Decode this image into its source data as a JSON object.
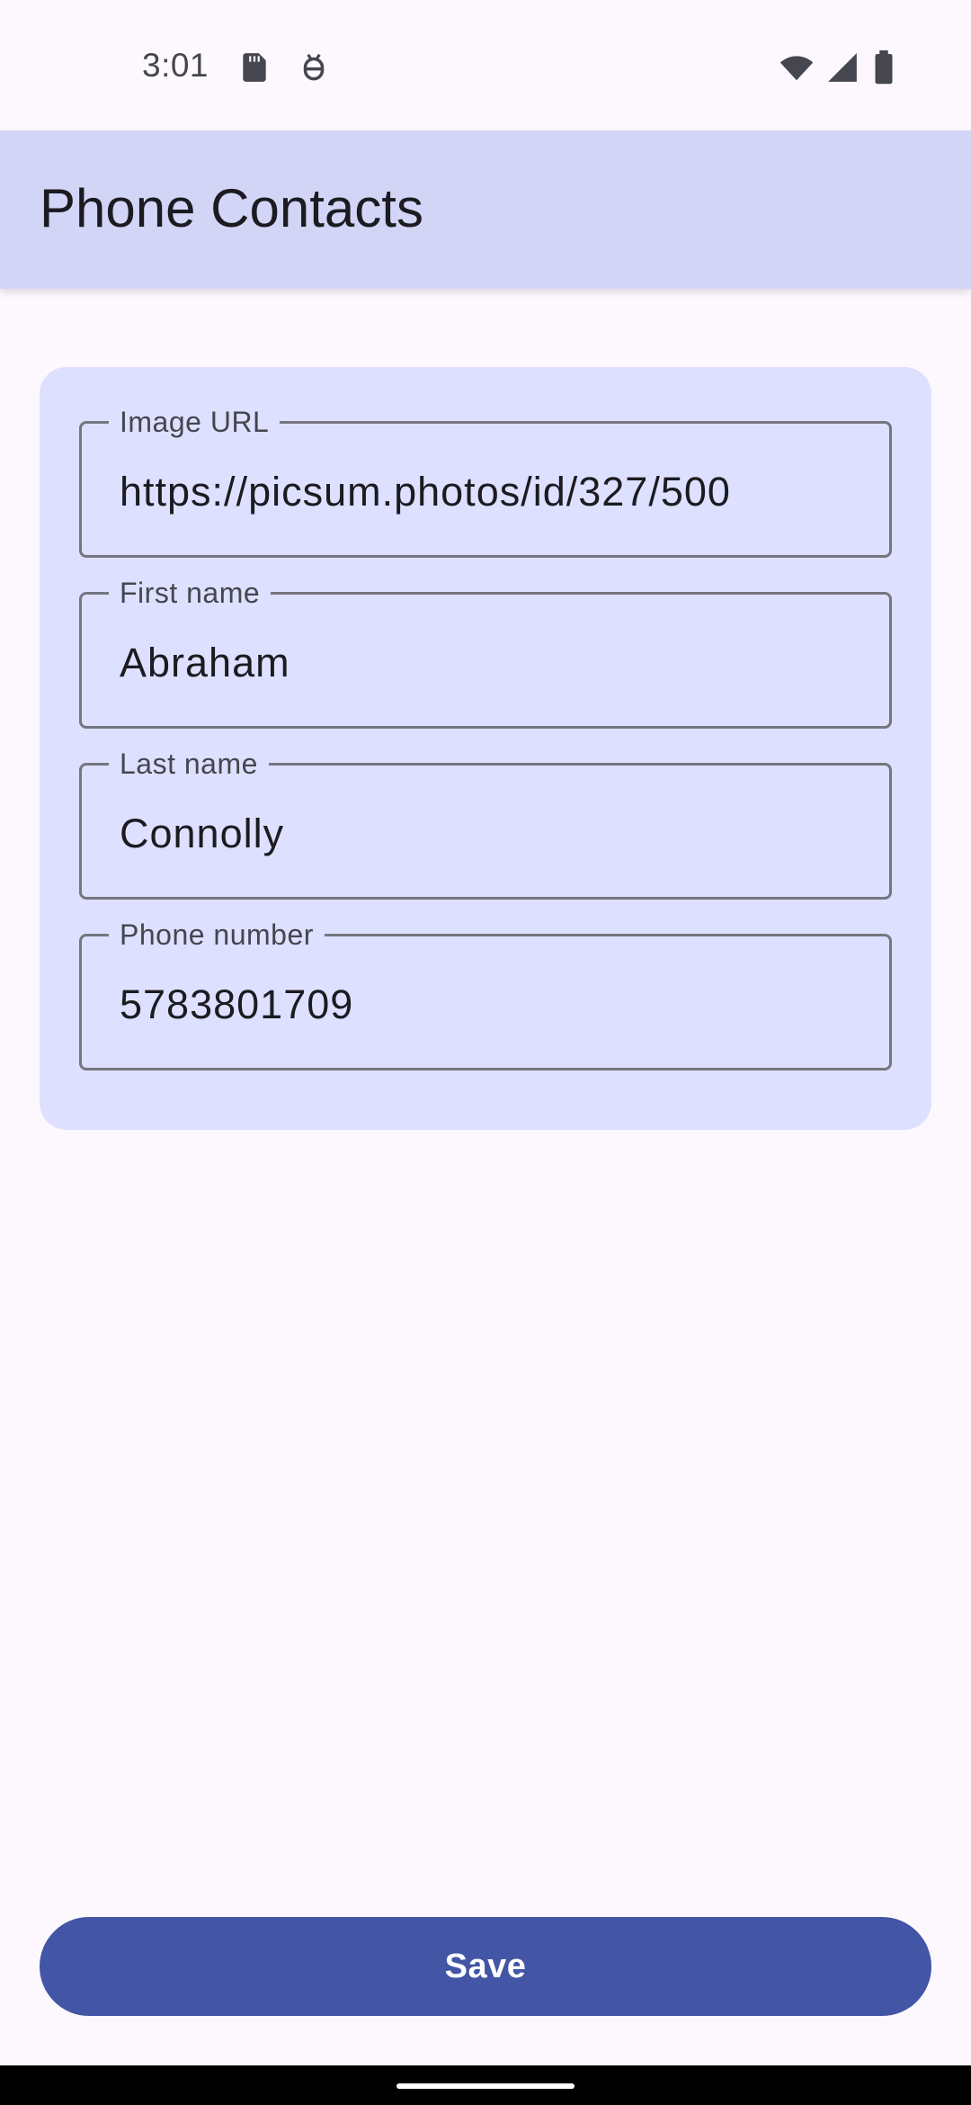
{
  "status_bar": {
    "time": "3:01",
    "left_icons": [
      "sd-card-icon",
      "android-debug-icon"
    ],
    "right_icons": [
      "wifi-icon",
      "cellular-signal-icon",
      "battery-icon"
    ]
  },
  "app_bar": {
    "title": "Phone Contacts"
  },
  "form": {
    "fields": [
      {
        "label": "Image URL",
        "value": "https://picsum.photos/id/327/500"
      },
      {
        "label": "First name",
        "value": "Abraham"
      },
      {
        "label": "Last name",
        "value": "Connolly"
      },
      {
        "label": "Phone number",
        "value": "5783801709"
      }
    ]
  },
  "actions": {
    "save_label": "Save"
  },
  "colors": {
    "app_bar_bg": "#d2d5f6",
    "card_bg": "#dee0ff",
    "primary": "#4355a5",
    "background": "#fcf8fd"
  }
}
